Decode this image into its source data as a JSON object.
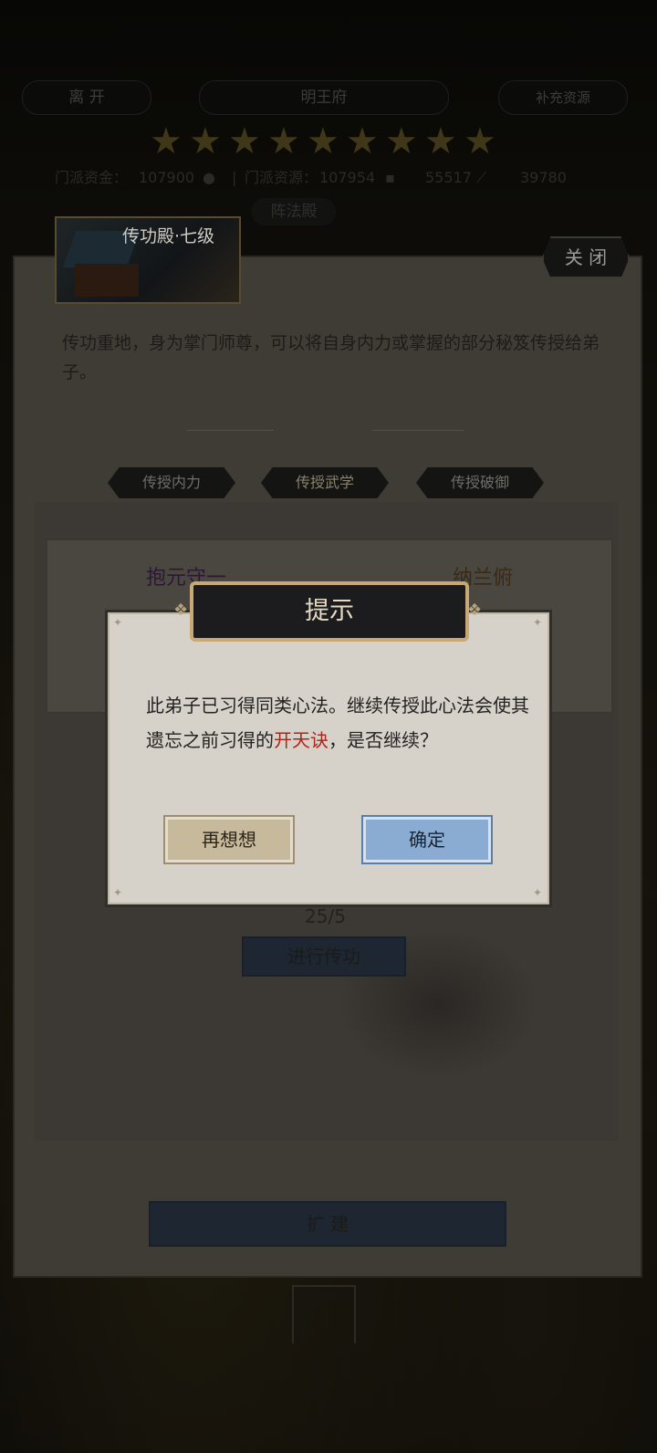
{
  "top_bar": {
    "leave": "离 开",
    "sect_name": "明王府",
    "supplement": "补充资源"
  },
  "stars": {
    "count": 9,
    "color": "#3f3718"
  },
  "stats": {
    "funds_label": "门派资金：",
    "funds_value": "107900",
    "resources_label": "门派资源：",
    "resources_value": "107954",
    "value3": "55517",
    "value4": "39780"
  },
  "hall_tag": "阵法殿",
  "hall": {
    "name": "传功殿·七级",
    "close": "关 闭"
  },
  "description": "传功重地，身为掌门师尊，可以将自身内力或掌握的部分秘笈传授给弟子。",
  "tabs": [
    "传授内力",
    "传授武学",
    "传授破御"
  ],
  "slots": {
    "left_name": "抱元守一",
    "right_name": "纳兰俯"
  },
  "count": "25/5",
  "action_button": "进行传功",
  "expand_button": "扩  建",
  "dialog": {
    "title": "提示",
    "message_part1": "此弟子已习得同类心法。继续传授此心法会使其遗忘之前习得的",
    "highlight": "开天诀",
    "message_part2": "，是否继续？",
    "cancel": "再想想",
    "confirm": "确定",
    "highlight_color": "#b0231b"
  }
}
